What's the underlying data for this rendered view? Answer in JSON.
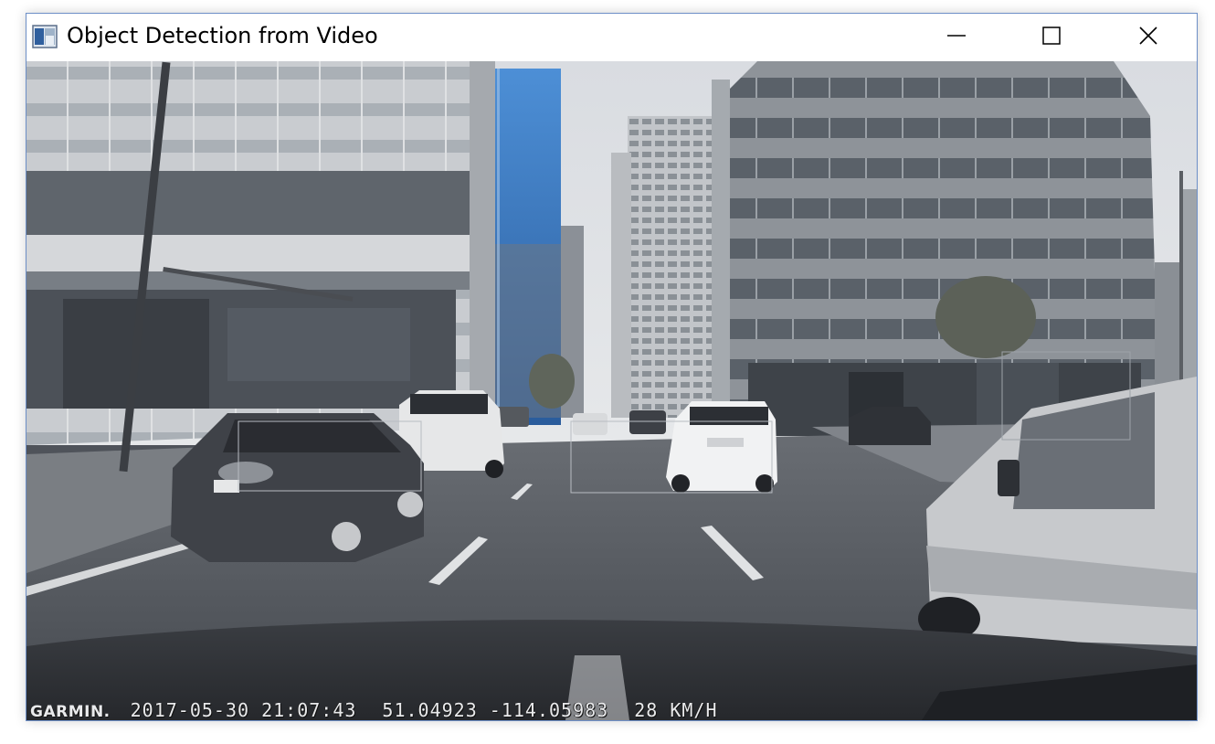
{
  "window": {
    "title": "Object Detection from Video",
    "icon": "app-window-icon",
    "controls": {
      "minimize_icon": "minimize-icon",
      "maximize_icon": "maximize-icon",
      "close_icon": "close-icon"
    }
  },
  "video_overlay": {
    "brand": "GARMIN.",
    "datetime": "2017-05-30 21:07:43",
    "coordinates": "51.04923 -114.05983",
    "speed": "28 KM/H"
  },
  "colors": {
    "window_border": "#6d8fc7",
    "overlay_text": "#e9eaec",
    "detection_box": "#b8bcc2"
  }
}
